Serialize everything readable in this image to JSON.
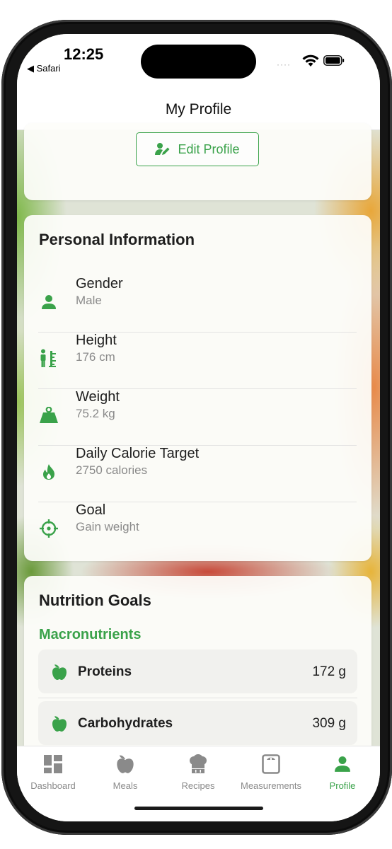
{
  "status": {
    "time": "12:25",
    "back_app": "◀ Safari",
    "signal_dots": "····"
  },
  "header": {
    "title": "My Profile"
  },
  "profile_card": {
    "edit_label": "Edit Profile"
  },
  "personal": {
    "title": "Personal Information",
    "items": [
      {
        "icon": "person-icon",
        "label": "Gender",
        "value": "Male"
      },
      {
        "icon": "height-ruler-icon",
        "label": "Height",
        "value": "176 cm"
      },
      {
        "icon": "weight-icon",
        "label": "Weight",
        "value": "75.2 kg"
      },
      {
        "icon": "flame-icon",
        "label": "Daily Calorie Target",
        "value": "2750 calories"
      },
      {
        "icon": "target-icon",
        "label": "Goal",
        "value": "Gain weight"
      }
    ]
  },
  "nutrition": {
    "title": "Nutrition Goals",
    "subtitle": "Macronutrients",
    "items": [
      {
        "icon": "apple-icon",
        "name": "Proteins",
        "value": "172 g"
      },
      {
        "icon": "apple-icon",
        "name": "Carbohydrates",
        "value": "309 g"
      }
    ]
  },
  "tabs": [
    {
      "icon": "dashboard-icon",
      "label": "Dashboard",
      "active": false
    },
    {
      "icon": "apple-icon",
      "label": "Meals",
      "active": false
    },
    {
      "icon": "chef-hat-icon",
      "label": "Recipes",
      "active": false
    },
    {
      "icon": "scale-icon",
      "label": "Measurements",
      "active": false
    },
    {
      "icon": "person-icon",
      "label": "Profile",
      "active": true
    }
  ],
  "colors": {
    "accent": "#3aa24a",
    "text": "#1e1e1e",
    "muted": "#8a8a8a",
    "inactive_tab": "#8a8a8a"
  }
}
